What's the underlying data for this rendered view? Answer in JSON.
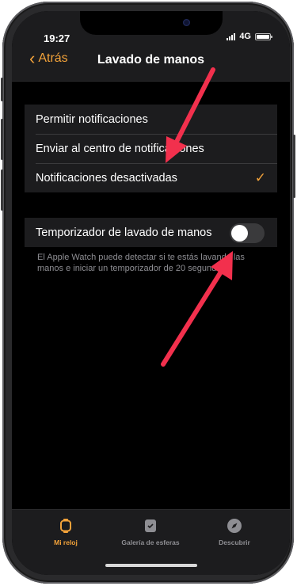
{
  "status": {
    "time": "19:27",
    "network": "4G"
  },
  "nav": {
    "back_label": "Atrás",
    "title": "Lavado de manos"
  },
  "notifications": {
    "options": [
      {
        "label": "Permitir notificaciones",
        "selected": false
      },
      {
        "label": "Enviar al centro de notificaciones",
        "selected": false
      },
      {
        "label": "Notificaciones desactivadas",
        "selected": true
      }
    ],
    "check_glyph": "✓"
  },
  "timer": {
    "label": "Temporizador de lavado de manos",
    "enabled": false,
    "description": "El Apple Watch puede detectar si te estás lavando las manos e iniciar un temporizador de 20 segundos."
  },
  "tabs": [
    {
      "label": "Mi reloj",
      "icon": "watch-icon",
      "active": true
    },
    {
      "label": "Galería de esferas",
      "icon": "watch-face-gallery-icon",
      "active": false
    },
    {
      "label": "Descubrir",
      "icon": "compass-icon",
      "active": false
    }
  ],
  "colors": {
    "accent": "#f2a23a",
    "annotation_arrow": "#f2304d",
    "background": "#000000",
    "cell": "#1c1c1e"
  }
}
